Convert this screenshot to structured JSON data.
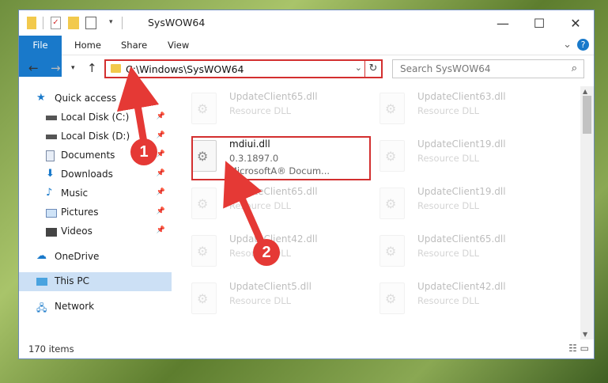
{
  "window": {
    "title": "SysWOW64",
    "controls": {
      "minimize": "—",
      "maximize": "☐",
      "close": "✕"
    }
  },
  "ribbon": {
    "tabs": [
      {
        "label": "File"
      },
      {
        "label": "Home"
      },
      {
        "label": "Share"
      },
      {
        "label": "View"
      }
    ],
    "help_glyph": "?",
    "expand_glyph": "⌄"
  },
  "address": {
    "path": "C:\\Windows\\SysWOW64",
    "dropdown_glyph": "⌄",
    "refresh_glyph": "↻"
  },
  "search": {
    "placeholder": "Search SysWOW64",
    "icon": "search-icon"
  },
  "nav": {
    "items": [
      {
        "label": "Quick access",
        "icon": "star-icon",
        "pinned": false
      },
      {
        "label": "Local Disk (C:)",
        "icon": "drive-icon",
        "pinned": true
      },
      {
        "label": "Local Disk (D:)",
        "icon": "drive-icon",
        "pinned": true
      },
      {
        "label": "Documents",
        "icon": "documents-icon",
        "pinned": true
      },
      {
        "label": "Downloads",
        "icon": "downloads-icon",
        "pinned": true
      },
      {
        "label": "Music",
        "icon": "music-icon",
        "pinned": true
      },
      {
        "label": "Pictures",
        "icon": "pictures-icon",
        "pinned": true
      },
      {
        "label": "Videos",
        "icon": "videos-icon",
        "pinned": true
      },
      {
        "label": "OneDrive",
        "icon": "onedrive-icon",
        "pinned": false
      },
      {
        "label": "This PC",
        "icon": "pc-icon",
        "pinned": false,
        "selected": true
      },
      {
        "label": "Network",
        "icon": "network-icon",
        "pinned": false
      }
    ]
  },
  "files": [
    {
      "name": "UpdateClient65.dll",
      "type": "Resource DLL"
    },
    {
      "name": "UpdateClient63.dll",
      "type": "Resource DLL"
    },
    {
      "name": "mdiui.dll",
      "version": "0.3.1897.0",
      "company": "MicrosoftA® Docum...",
      "highlight": true
    },
    {
      "name": "UpdateClient19.dll",
      "type": "Resource DLL"
    },
    {
      "name": "UpdateClient65.dll",
      "type": "Resource DLL"
    },
    {
      "name": "UpdateClient19.dll",
      "type": "Resource DLL"
    },
    {
      "name": "UpdateClient42.dll",
      "type": "Resource DLL"
    },
    {
      "name": "UpdateClient65.dll",
      "type": "Resource DLL"
    },
    {
      "name": "UpdateClient5.dll",
      "type": "Resource DLL"
    },
    {
      "name": "UpdateClient42.dll",
      "type": "Resource DLL"
    }
  ],
  "status": {
    "count": "170 items"
  },
  "markers": [
    {
      "label": "1"
    },
    {
      "label": "2"
    }
  ],
  "colors": {
    "accent": "#1979ca",
    "highlight": "#d32f2f",
    "selection": "#cce0f5"
  }
}
